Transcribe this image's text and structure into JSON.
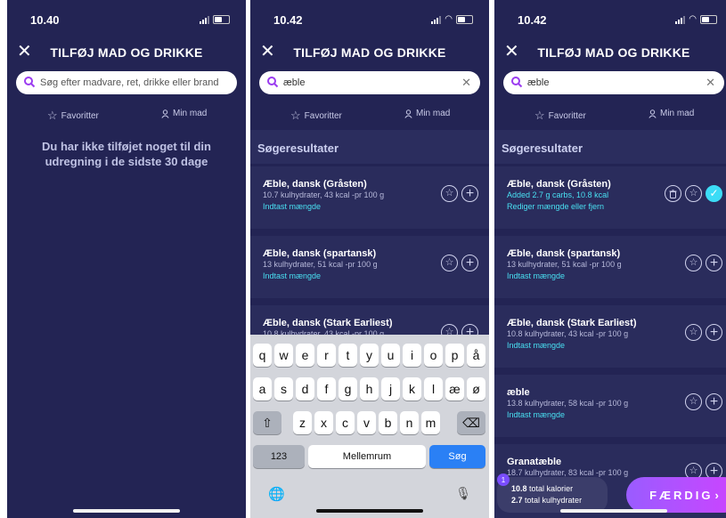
{
  "title": "TILFØJ MAD OG DRIKKE",
  "close_glyph": "✕",
  "favorites_tab": "Favoritter",
  "my_food_tab": "Min mad",
  "results_heading": "Søgeresultater",
  "colors": {
    "background": "#232454",
    "card": "#2a2c5c",
    "accent_cyan": "#49e0f2",
    "done_button": "#b04cff",
    "keyboard_blue": "#2a80f5"
  },
  "icons": {
    "search": "magnifier-icon",
    "favorite": "star-icon",
    "my_food": "person-icon",
    "add": "plus-circle-icon",
    "delete": "trash-icon",
    "added": "checkmark-icon",
    "close": "close-icon",
    "globe": "globe-icon",
    "mic": "microphone-icon",
    "shift": "shift-icon",
    "backspace": "backspace-icon"
  },
  "phone1": {
    "time": "10.40",
    "search_placeholder": "Søg efter madvare, ret, drikke eller brand",
    "empty_message": "Du har ikke tilføjet noget til din udregning i de sidste 30 dage"
  },
  "phone2": {
    "time": "10.42",
    "search_value": "æble",
    "results": [
      {
        "name": "Æble, dansk (Gråsten)",
        "meta": "10.7 kulhydrater, 43 kcal -pr 100 g",
        "link": "Indtast mængde"
      },
      {
        "name": "Æble, dansk (spartansk)",
        "meta": "13 kulhydrater, 51 kcal -pr 100 g",
        "link": "Indtast mængde"
      },
      {
        "name": "Æble, dansk (Stark Earliest)",
        "meta": "10.8 kulhydrater, 43 kcal -pr 100 g",
        "link": ""
      }
    ],
    "keyboard": {
      "row1": [
        "q",
        "w",
        "e",
        "r",
        "t",
        "y",
        "u",
        "i",
        "o",
        "p",
        "å"
      ],
      "row2": [
        "a",
        "s",
        "d",
        "f",
        "g",
        "h",
        "j",
        "k",
        "l",
        "æ",
        "ø"
      ],
      "row3": [
        "z",
        "x",
        "c",
        "v",
        "b",
        "n",
        "m"
      ],
      "shift_glyph": "⇧",
      "backspace_glyph": "⌫",
      "numbers": "123",
      "space": "Mellemrum",
      "search": "Søg",
      "globe_glyph": "🌐",
      "mic_glyph": "🎙"
    }
  },
  "phone3": {
    "time": "10.42",
    "search_value": "æble",
    "results": [
      {
        "name": "Æble, dansk (Gråsten)",
        "meta": "Added 2.7 g carbs, 10.8 kcal",
        "link": "Rediger mængde eller fjern",
        "added": true
      },
      {
        "name": "Æble, dansk (spartansk)",
        "meta": "13 kulhydrater, 51 kcal -pr 100 g",
        "link": "Indtast mængde"
      },
      {
        "name": "Æble, dansk (Stark Earliest)",
        "meta": "10.8 kulhydrater, 43 kcal -pr 100 g",
        "link": "Indtast mængde"
      },
      {
        "name": "æble",
        "meta": "13.8 kulhydrater, 58 kcal -pr 100 g",
        "link": "Indtast mængde"
      },
      {
        "name": "Granatæble",
        "meta": "18.7 kulhydrater, 83 kcal -pr 100 g",
        "link": ""
      }
    ],
    "totals": {
      "count": "1",
      "kcal_value": "10.8",
      "kcal_label": "total kalorier",
      "carbs_value": "2.7",
      "carbs_label": "total kulhydrater"
    },
    "done_label": "FÆRDIG"
  }
}
